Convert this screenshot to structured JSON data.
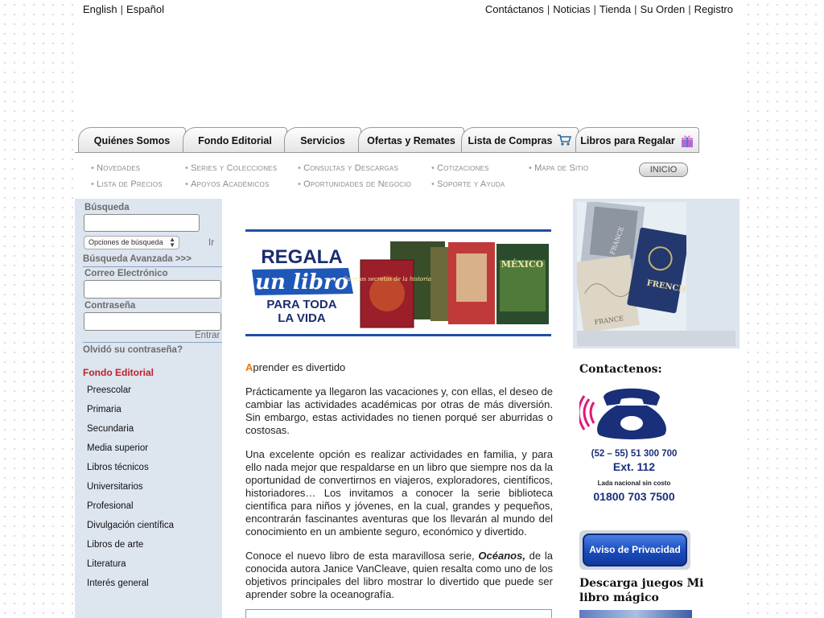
{
  "lang": {
    "english": "English",
    "spanish": "Español"
  },
  "toplinks": [
    "Contáctanos",
    "Noticias",
    "Tienda",
    "Su Orden",
    "Registro"
  ],
  "tabs": [
    {
      "label": "Quiénes Somos"
    },
    {
      "label": "Fondo Editorial"
    },
    {
      "label": "Servicios"
    },
    {
      "label": "Ofertas y Remates"
    },
    {
      "label": "Lista de Compras",
      "icon": "shopping-cart-icon"
    },
    {
      "label": "Libros para Regalar",
      "icon": "gift-icon"
    }
  ],
  "subnav": {
    "col1": [
      "Novedades",
      "Lista de Precios"
    ],
    "col2": [
      "Series y Colecciones",
      "Apoyos Académicos"
    ],
    "col3": [
      "Consultas y Descargas",
      "Oportunidades de Negocio"
    ],
    "col4": [
      "Cotizaciones",
      "Soporte y Ayuda"
    ],
    "col5": [
      "Mapa de Sitio"
    ],
    "inicio": "INICIO"
  },
  "sidebar": {
    "search_label": "Búsqueda",
    "search_options": "Opciones de búsqueda",
    "go": "Ir",
    "advanced": "Búsqueda Avanzada >>>",
    "email_label": "Correo Electrónico",
    "password_label": "Contraseña",
    "login": "Entrar",
    "forgot": "Olvidó su contraseña?",
    "section_title": "Fondo Editorial",
    "categories": [
      "Preescolar",
      "Primaria",
      "Secundaria",
      "Media superior",
      "Libros técnicos",
      "Universitarios",
      "Profesional",
      "Divulgación científica",
      "Libros de arte",
      "Literatura",
      "Interés general"
    ]
  },
  "banner": {
    "line1": "REGALA",
    "line2": "un libro",
    "line3": "PARA TODA",
    "line4": "LA VIDA",
    "book1": "Cuentos secretos de la historia",
    "book4": "MÉXICO"
  },
  "article": {
    "first_letter": "A",
    "title_rest": "prender es divertido",
    "p1": "Prácticamente ya llegaron las vacaciones y, con ellas, el deseo de cambiar las actividades académicas por otras de más diversión. Sin embargo, estas actividades no tienen porqué ser aburridas o costosas.",
    "p2": " Una excelente opción es realizar actividades en familia, y para ello nada mejor que respaldarse en un libro que siempre nos da la oportunidad de convertirnos en viajeros, exploradores, científicos, historiadores… Los invitamos a conocer la serie biblioteca científica para niños y jóvenes, en la cual, grandes y pequeños, encontrarán fascinantes aventuras que los llevarán al mundo del conocimiento en un ambiente seguro, económico y divertido.",
    "p3_pre": " Conoce el nuevo libro de esta maravillosa serie, ",
    "p3_em": "Océanos,",
    "p3_post": " de la conocida autora Janice VanCleave, quien resalta como uno de los objetivos principales del libro mostrar lo divertido que puede ser aprender sobre la oceanografía."
  },
  "right": {
    "photo_book1": "FRANCE",
    "photo_book2": "FRENCH",
    "photo_book3": "FRANCE",
    "contact_heading": "Contactenos:",
    "phone1": "(52 – 55) 51 300 700",
    "ext": "Ext. 112",
    "lada": "Lada nacional sin costo",
    "phone2": "01800 703 7500",
    "aviso": "Aviso de Privacidad",
    "download_heading": "Descarga juegos Mi libro mágico"
  },
  "colors": {
    "accent_red": "#c0202a",
    "accent_orange": "#e07a10",
    "phone_blue": "#1a2f7a",
    "phone_pink": "#e0187a"
  }
}
